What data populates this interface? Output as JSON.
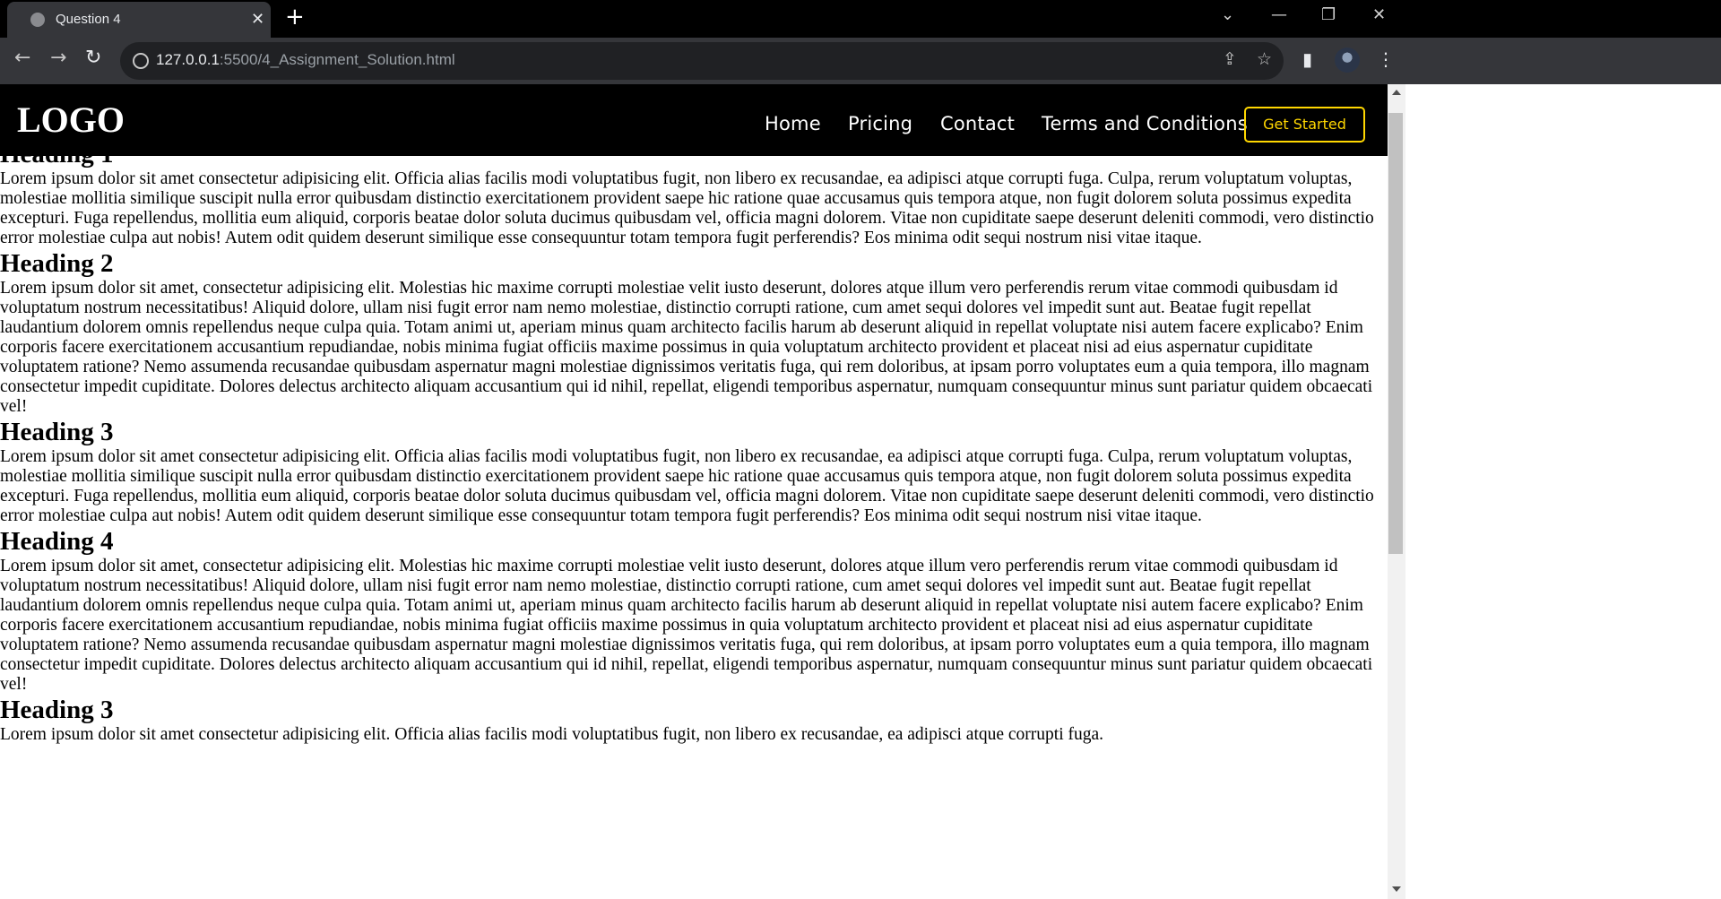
{
  "browser": {
    "tab_title": "Question 4",
    "close_glyph": "✕",
    "new_tab_glyph": "+",
    "url_host": "127.0.0.1",
    "url_path": ":5500/4_Assignment_Solution.html",
    "window_controls": {
      "tab_search": "⌄",
      "minimize": "—",
      "restore": "❐",
      "close": "✕"
    },
    "nav": {
      "back": "←",
      "forward": "→",
      "reload": "↻"
    },
    "icons": {
      "share": "⇪",
      "bookmark": "☆",
      "side_panel": "▮",
      "menu": "⋮"
    }
  },
  "site": {
    "logo": "LOGO",
    "nav": [
      "Home",
      "Pricing",
      "Contact",
      "Terms and Conditions"
    ],
    "cta": "Get Started",
    "accent_color": "#ffd700"
  },
  "content": {
    "sections": [
      {
        "heading": "Heading 1",
        "text": "Lorem ipsum dolor sit amet consectetur adipisicing elit. Officia alias facilis modi voluptatibus fugit, non libero ex recusandae, ea adipisci atque corrupti fuga. Culpa, rerum voluptatum voluptas, molestiae mollitia similique suscipit nulla error quibusdam distinctio exercitationem provident saepe hic ratione quae accusamus quis tempora atque, non fugit dolorem soluta possimus expedita excepturi. Fuga repellendus, mollitia eum aliquid, corporis beatae dolor soluta ducimus quibusdam vel, officia magni dolorem. Vitae non cupiditate saepe deserunt deleniti commodi, vero distinctio error molestiae culpa aut nobis! Autem odit quidem deserunt similique esse consequuntur totam tempora fugit perferendis? Eos minima odit sequi nostrum nisi vitae itaque."
      },
      {
        "heading": "Heading 2",
        "text": "Lorem ipsum dolor sit amet, consectetur adipisicing elit. Molestias hic maxime corrupti molestiae velit iusto deserunt, dolores atque illum vero perferendis rerum vitae commodi quibusdam id voluptatum nostrum necessitatibus! Aliquid dolore, ullam nisi fugit error nam nemo molestiae, distinctio corrupti ratione, cum amet sequi dolores vel impedit sunt aut. Beatae fugit repellat laudantium dolorem omnis repellendus neque culpa quia. Totam animi ut, aperiam minus quam architecto facilis harum ab deserunt aliquid in repellat voluptate nisi autem facere explicabo? Enim corporis facere exercitationem accusantium repudiandae, nobis minima fugiat officiis maxime possimus in quia voluptatum architecto provident et placeat nisi ad eius aspernatur cupiditate voluptatem ratione? Nemo assumenda recusandae quibusdam aspernatur magni molestiae dignissimos veritatis fuga, qui rem doloribus, at ipsam porro voluptates eum a quia tempora, illo magnam consectetur impedit cupiditate. Dolores delectus architecto aliquam accusantium qui id nihil, repellat, eligendi temporibus aspernatur, numquam consequuntur minus sunt pariatur quidem obcaecati vel!"
      },
      {
        "heading": "Heading 3",
        "text": "Lorem ipsum dolor sit amet consectetur adipisicing elit. Officia alias facilis modi voluptatibus fugit, non libero ex recusandae, ea adipisci atque corrupti fuga. Culpa, rerum voluptatum voluptas, molestiae mollitia similique suscipit nulla error quibusdam distinctio exercitationem provident saepe hic ratione quae accusamus quis tempora atque, non fugit dolorem soluta possimus expedita excepturi. Fuga repellendus, mollitia eum aliquid, corporis beatae dolor soluta ducimus quibusdam vel, officia magni dolorem. Vitae non cupiditate saepe deserunt deleniti commodi, vero distinctio error molestiae culpa aut nobis! Autem odit quidem deserunt similique esse consequuntur totam tempora fugit perferendis? Eos minima odit sequi nostrum nisi vitae itaque."
      },
      {
        "heading": "Heading 4",
        "text": "Lorem ipsum dolor sit amet, consectetur adipisicing elit. Molestias hic maxime corrupti molestiae velit iusto deserunt, dolores atque illum vero perferendis rerum vitae commodi quibusdam id voluptatum nostrum necessitatibus! Aliquid dolore, ullam nisi fugit error nam nemo molestiae, distinctio corrupti ratione, cum amet sequi dolores vel impedit sunt aut. Beatae fugit repellat laudantium dolorem omnis repellendus neque culpa quia. Totam animi ut, aperiam minus quam architecto facilis harum ab deserunt aliquid in repellat voluptate nisi autem facere explicabo? Enim corporis facere exercitationem accusantium repudiandae, nobis minima fugiat officiis maxime possimus in quia voluptatum architecto provident et placeat nisi ad eius aspernatur cupiditate voluptatem ratione? Nemo assumenda recusandae quibusdam aspernatur magni molestiae dignissimos veritatis fuga, qui rem doloribus, at ipsam porro voluptates eum a quia tempora, illo magnam consectetur impedit cupiditate. Dolores delectus architecto aliquam accusantium qui id nihil, repellat, eligendi temporibus aspernatur, numquam consequuntur minus sunt pariatur quidem obcaecati vel!"
      },
      {
        "heading": "Heading 3",
        "text": "Lorem ipsum dolor sit amet consectetur adipisicing elit. Officia alias facilis modi voluptatibus fugit, non libero ex recusandae, ea adipisci atque corrupti fuga."
      }
    ]
  }
}
